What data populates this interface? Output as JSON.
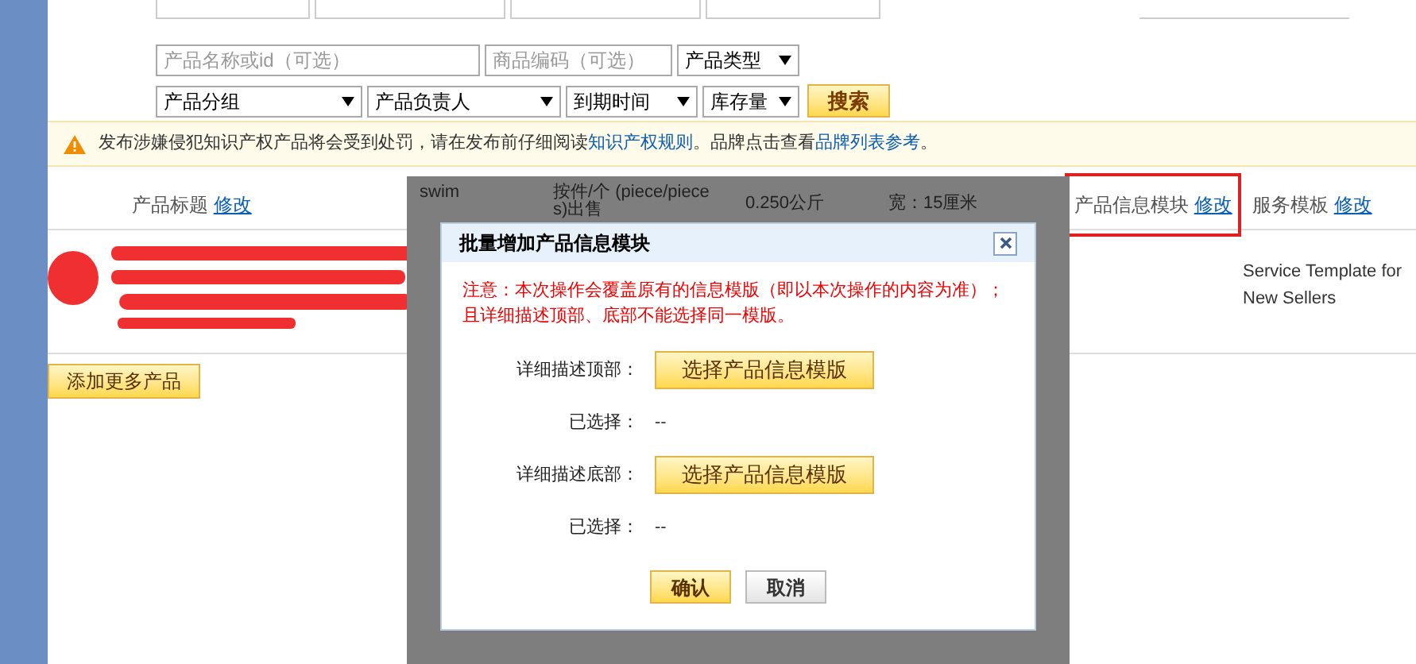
{
  "filters": {
    "row1": [
      {
        "kind": "input",
        "placeholder": "产品名称或id（可选）"
      },
      {
        "kind": "input",
        "placeholder": "商品编码（可选）"
      },
      {
        "kind": "select",
        "value": "产品类型"
      }
    ],
    "row2": [
      {
        "kind": "select",
        "value": "产品分组"
      },
      {
        "kind": "select",
        "value": "产品负责人"
      },
      {
        "kind": "select",
        "value": "到期时间"
      },
      {
        "kind": "select",
        "value": "库存量"
      }
    ],
    "search_button": "搜索"
  },
  "notice": {
    "text": "发布涉嫌侵犯知识产权产品将会受到处罚，请在发布前仔细阅读",
    "link1": "知识产权规则",
    "middle": "。品牌点击查看",
    "link2": "品牌列表参考",
    "end": "。"
  },
  "table": {
    "columns": [
      {
        "label": "产品标题",
        "link": "修改",
        "highlighted": false
      },
      {
        "label": "产品信息模块",
        "link": "修改",
        "highlighted": true
      },
      {
        "label": "服务模板",
        "link": "修改",
        "highlighted": false
      }
    ],
    "row": {
      "service_template": "Service Template for New Sellers"
    },
    "covered_cells": [
      "swim",
      "按件/个 (piece/piece",
      "s)出售",
      "0.250公斤",
      "宽：15厘米"
    ]
  },
  "add_button": "添加更多产品",
  "dialog": {
    "title": "批量增加产品信息模块",
    "warning": "注意：本次操作会覆盖原有的信息模版（即以本次操作的内容为准）；且详细描述顶部、底部不能选择同一模版。",
    "sections": [
      {
        "label": "详细描述顶部：",
        "button": "选择产品信息模版",
        "selected_label": "已选择：",
        "selected_value": "--"
      },
      {
        "label": "详细描述底部：",
        "button": "选择产品信息模版",
        "selected_label": "已选择：",
        "selected_value": "--"
      }
    ],
    "confirm": "确认",
    "cancel": "取消"
  }
}
